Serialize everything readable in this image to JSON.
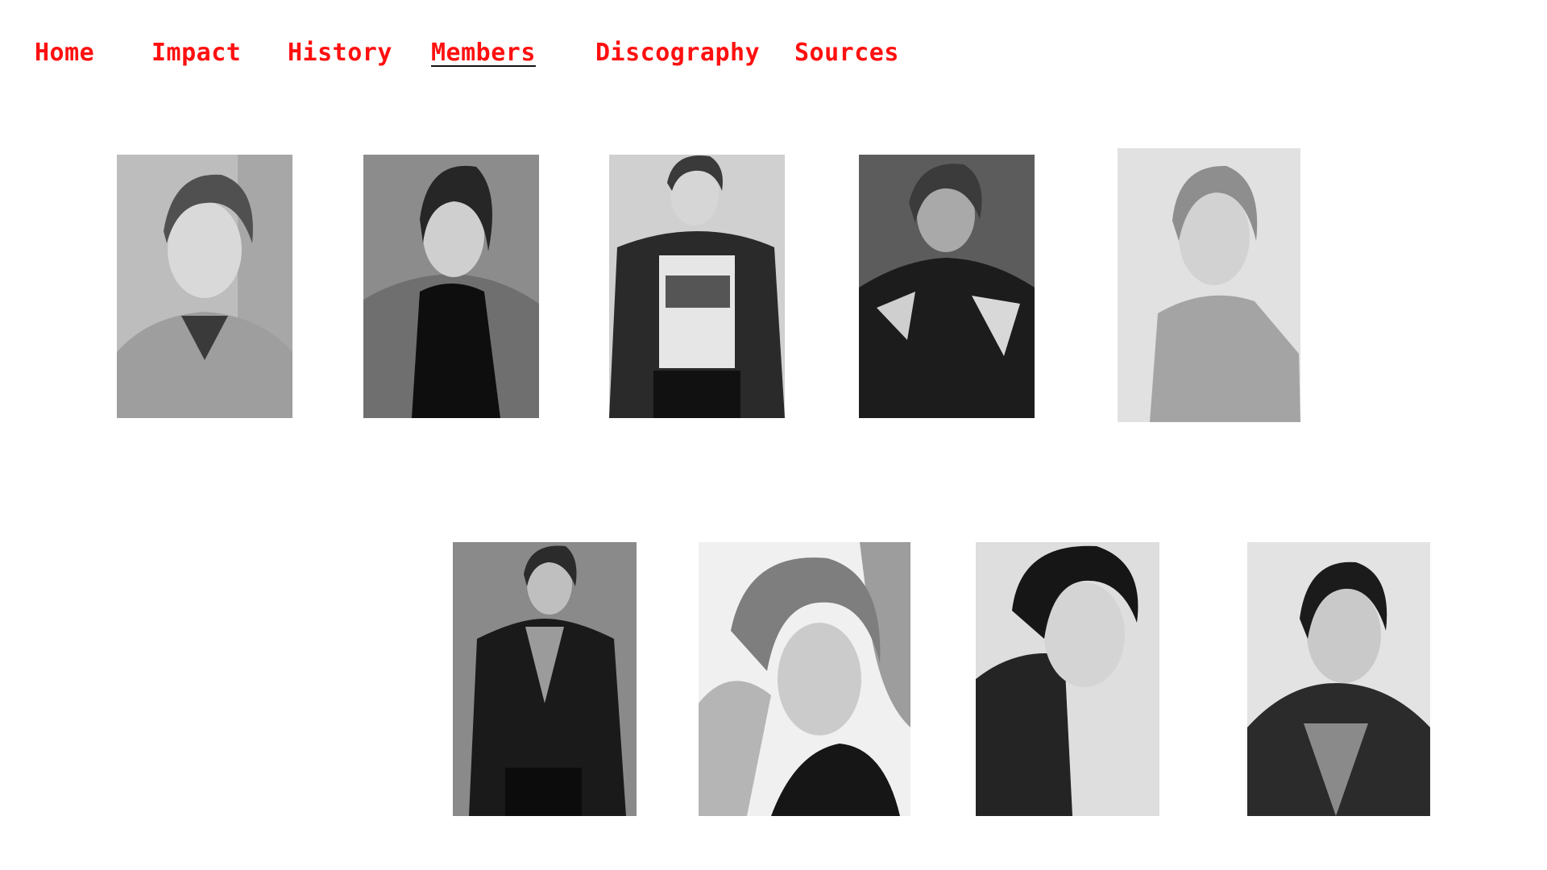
{
  "nav": {
    "items": [
      {
        "label": "Home",
        "active": false
      },
      {
        "label": "Impact",
        "active": false
      },
      {
        "label": "History",
        "active": false
      },
      {
        "label": "Members",
        "active": true
      },
      {
        "label": "Discography",
        "active": false
      },
      {
        "label": "Sources",
        "active": false
      }
    ],
    "link_color": "#ff1010",
    "active_underline_color": "#111111"
  },
  "gallery": {
    "rows": [
      {
        "photos": [
          {
            "icon": "member-photo-icon",
            "tone": "light"
          },
          {
            "icon": "member-photo-icon",
            "tone": "dark"
          },
          {
            "icon": "member-photo-icon",
            "tone": "mid"
          },
          {
            "icon": "member-photo-icon",
            "tone": "dark"
          },
          {
            "icon": "member-photo-icon",
            "tone": "light"
          }
        ]
      },
      {
        "photos": [
          {
            "icon": "member-photo-icon",
            "tone": "dark"
          },
          {
            "icon": "member-photo-icon",
            "tone": "mid"
          },
          {
            "icon": "member-photo-icon",
            "tone": "light"
          },
          {
            "icon": "member-photo-icon",
            "tone": "light"
          }
        ]
      }
    ]
  }
}
